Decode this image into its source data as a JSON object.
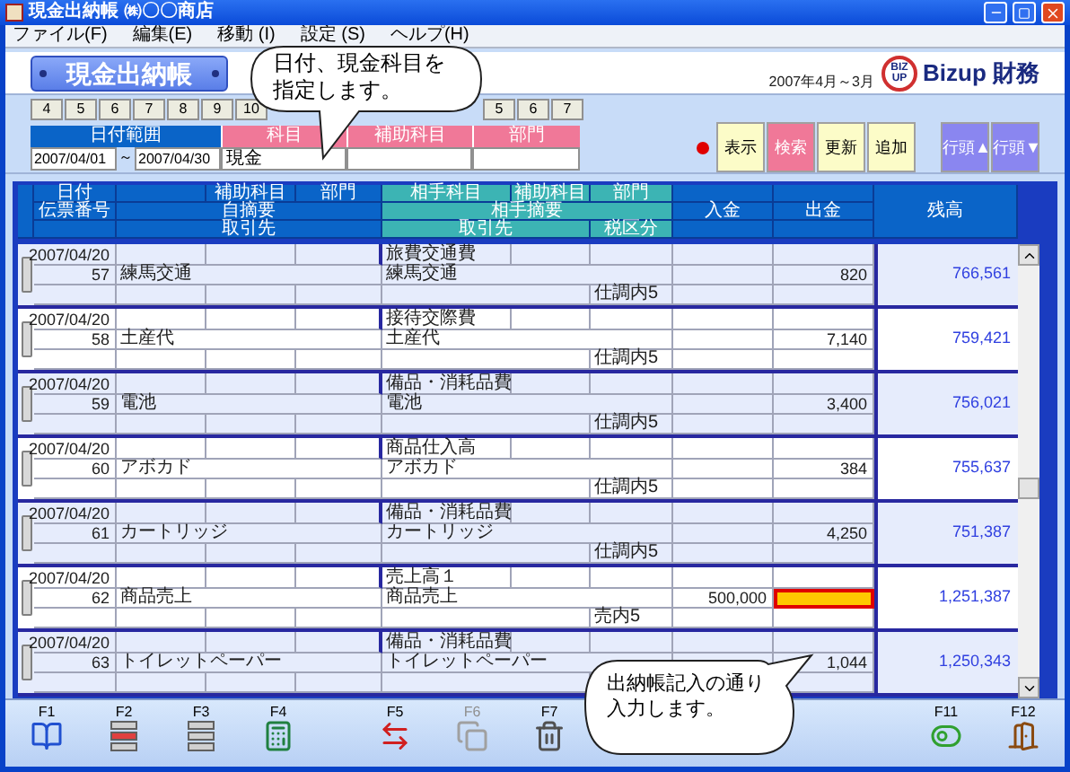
{
  "window": {
    "title": "現金出納帳 ㈱〇〇商店"
  },
  "menu": [
    "ファイル(F)",
    "編集(E)",
    "移動 (I)",
    "設定 (S)",
    "ヘルプ(H)"
  ],
  "header": {
    "title": "現金出納帳",
    "period": "2007年4月～3月",
    "logo_badge_top": "BIZ",
    "logo_badge_bottom": "UP",
    "logo_text": "Bizup 財務"
  },
  "month_tabs": [
    "4",
    "5",
    "6",
    "7",
    "8",
    "9",
    "10",
    "5",
    "6",
    "7"
  ],
  "filter": {
    "labels": [
      {
        "text": "日付範囲",
        "kind": "date"
      },
      {
        "text": "科目",
        "kind": "account"
      },
      {
        "text": "補助科目",
        "kind": "account"
      },
      {
        "text": "部門",
        "kind": "account"
      }
    ],
    "date_from": "2007/04/01",
    "range_sep": "～",
    "date_to": "2007/04/30",
    "account": "現金"
  },
  "buttons": [
    {
      "label": "表示",
      "kind": "action"
    },
    {
      "label": "検索",
      "kind": "search"
    },
    {
      "label": "更新",
      "kind": "action"
    },
    {
      "label": "追加",
      "kind": "action"
    },
    {
      "label": "行頭▲",
      "kind": "nav"
    },
    {
      "label": "行頭▼",
      "kind": "nav"
    }
  ],
  "table": {
    "header": {
      "date": "日付",
      "sub_account": "補助科目",
      "department": "部門",
      "counter_account": "相手科目",
      "counter_sub_account": "補助科目",
      "counter_department": "部門",
      "balance": "残高",
      "slip_no": "伝票番号",
      "memo": "自摘要",
      "counter_memo": "相手摘要",
      "deposit": "入金",
      "withdrawal": "出金",
      "partner": "取引先",
      "counter_partner": "取引先",
      "tax_class": "税区分"
    },
    "rows": [
      {
        "date": "2007/04/20",
        "no": "57",
        "memo": "練馬交通",
        "counter_account": "旅費交通費",
        "counter_memo": "練馬交通",
        "tax_class": "仕調内5",
        "withdrawal": "820",
        "balance": "766,561",
        "editing": false
      },
      {
        "date": "2007/04/20",
        "no": "58",
        "memo": "土産代",
        "counter_account": "接待交際費",
        "counter_memo": "土産代",
        "tax_class": "仕調内5",
        "withdrawal": "7,140",
        "balance": "759,421",
        "editing": false
      },
      {
        "date": "2007/04/20",
        "no": "59",
        "memo": "電池",
        "counter_account": "備品・消耗品費",
        "counter_memo": "電池",
        "tax_class": "仕調内5",
        "withdrawal": "3,400",
        "balance": "756,021",
        "editing": false
      },
      {
        "date": "2007/04/20",
        "no": "60",
        "memo": "アボカド",
        "counter_account": "商品仕入高",
        "counter_memo": "アボカド",
        "tax_class": "仕調内5",
        "withdrawal": "384",
        "balance": "755,637",
        "editing": false
      },
      {
        "date": "2007/04/20",
        "no": "61",
        "memo": "カートリッジ",
        "counter_account": "備品・消耗品費",
        "counter_memo": "カートリッジ",
        "tax_class": "仕調内5",
        "withdrawal": "4,250",
        "balance": "751,387",
        "editing": false
      },
      {
        "date": "2007/04/20",
        "no": "62",
        "memo": "商品売上",
        "counter_account": "売上高１",
        "counter_memo": "商品売上",
        "tax_class": "売内5",
        "deposit": "500,000",
        "balance": "1,251,387",
        "editing": true
      },
      {
        "date": "2007/04/20",
        "no": "63",
        "memo": "トイレットペーパー",
        "counter_account": "備品・消耗品費",
        "counter_memo": "トイレットペーパー",
        "withdrawal": "1,044",
        "balance": "1,250,343",
        "editing": false
      }
    ]
  },
  "function_keys": [
    {
      "key": "F1",
      "kind": "help",
      "disabled": false
    },
    {
      "key": "F2",
      "kind": "move-in",
      "disabled": false
    },
    {
      "key": "F3",
      "kind": "move-out",
      "disabled": false
    },
    {
      "key": "F4",
      "kind": "calculator",
      "disabled": false
    },
    {
      "key": "F5",
      "kind": "swap",
      "disabled": false
    },
    {
      "key": "F6",
      "kind": "copy",
      "disabled": true
    },
    {
      "key": "F7",
      "kind": "trash",
      "disabled": false
    },
    {
      "key": "F11",
      "kind": "toggle",
      "disabled": false
    },
    {
      "key": "F12",
      "kind": "door",
      "disabled": false
    }
  ],
  "callouts": [
    "日付、現金科目を指定します。",
    "出納帳記入の通り入力します。"
  ]
}
